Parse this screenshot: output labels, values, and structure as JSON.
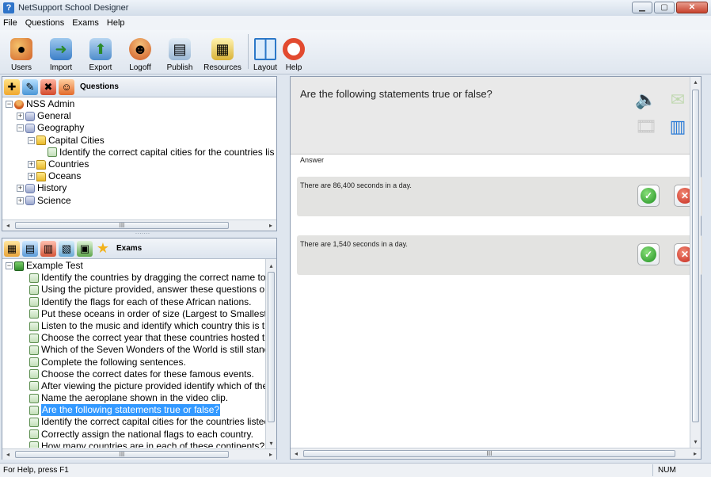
{
  "window": {
    "title": "NetSupport School Designer"
  },
  "menu": [
    "File",
    "Questions",
    "Exams",
    "Help"
  ],
  "toolbar": [
    {
      "label": "Users",
      "icon": "users-icon"
    },
    {
      "label": "Import",
      "icon": "import-icon"
    },
    {
      "label": "Export",
      "icon": "export-icon"
    },
    {
      "label": "Logoff",
      "icon": "logoff-icon"
    },
    {
      "label": "Publish",
      "icon": "publish-icon"
    },
    {
      "label": "Resources",
      "icon": "resources-icon"
    },
    {
      "label": "Layout",
      "icon": "layout-icon"
    },
    {
      "label": "Help",
      "icon": "help-lifebuoy-icon"
    }
  ],
  "questions_pane": {
    "title": "Questions",
    "tree": [
      {
        "label": "NSS Admin",
        "level": 0,
        "icon": "user",
        "expander": "−"
      },
      {
        "label": "General",
        "level": 1,
        "icon": "db",
        "expander": "+"
      },
      {
        "label": "Geography",
        "level": 1,
        "icon": "db",
        "expander": "−"
      },
      {
        "label": "Capital Cities",
        "level": 2,
        "icon": "folder",
        "expander": "−"
      },
      {
        "label": "Identify the correct capital cities for the countries lis",
        "level": 3,
        "icon": "q",
        "expander": ""
      },
      {
        "label": "Countries",
        "level": 2,
        "icon": "folder",
        "expander": "+"
      },
      {
        "label": "Oceans",
        "level": 2,
        "icon": "folder",
        "expander": "+"
      },
      {
        "label": "History",
        "level": 1,
        "icon": "db",
        "expander": "+"
      },
      {
        "label": "Science",
        "level": 1,
        "icon": "db",
        "expander": "+"
      }
    ]
  },
  "exams_pane": {
    "title": "Exams",
    "root": "Example Test",
    "items": [
      "Identify the countries by dragging the correct name to",
      "Using the picture provided, answer these questions o",
      "Identify the flags for each of these African nations.",
      "Put these oceans in order of size (Largest to Smallest",
      "Listen to the music and identify which country this is the",
      "Choose the correct year that these countries hosted th",
      "Which of the Seven Wonders of the World is still stanc",
      "Complete the following sentences.",
      "Choose the correct dates for these famous events.",
      "After viewing the picture provided identify which of the",
      "Name the aeroplane shown in the video clip.",
      "Are the following statements true or false?",
      "Identify the correct capital cities for the countries listec",
      "Correctly assign the national flags to each country.",
      "How many countries are in each of these continents?"
    ],
    "selected_index": 11
  },
  "editor": {
    "question": "Are the following statements true or false?",
    "answer_label": "Answer",
    "answers": [
      "There are 86,400 seconds in a day.",
      "There are 1,540 seconds in a day."
    ]
  },
  "scroll_thumb_text": "III",
  "statusbar": {
    "help": "For Help, press F1",
    "num": "NUM"
  }
}
